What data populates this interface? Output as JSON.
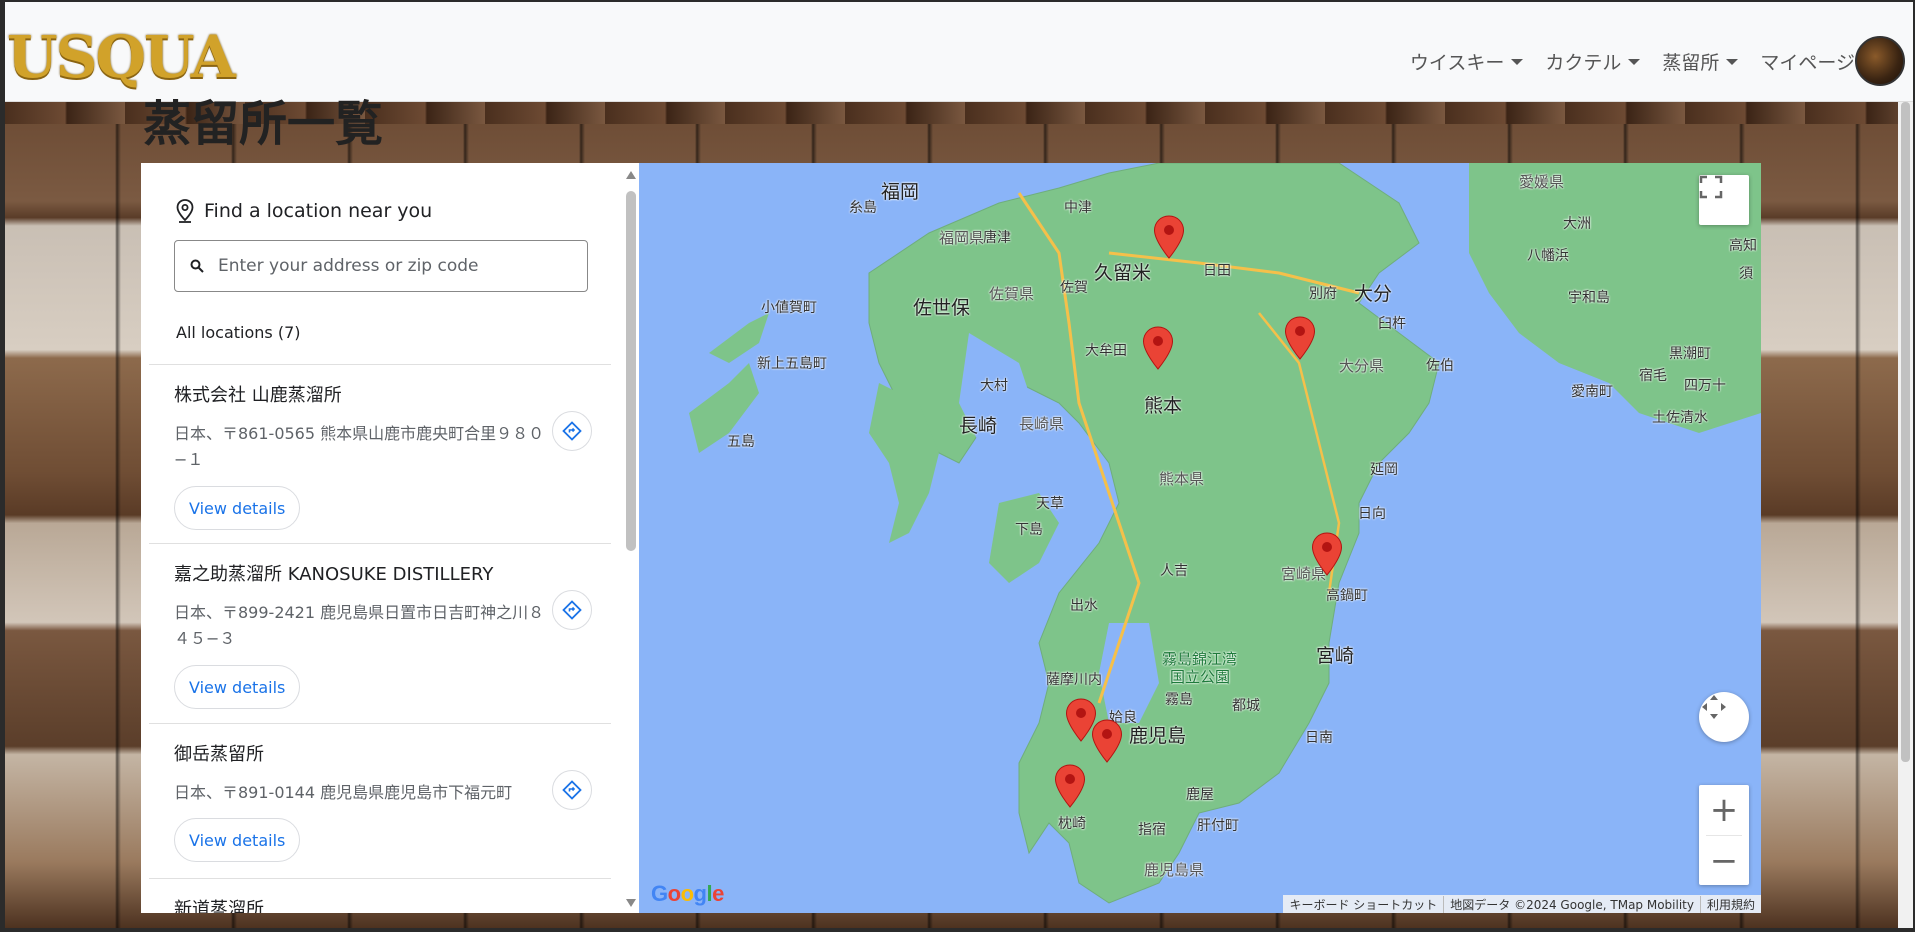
{
  "brand": "USQUA",
  "nav": {
    "items": [
      {
        "label": "ウイスキー",
        "dropdown": true
      },
      {
        "label": "カクテル",
        "dropdown": true
      },
      {
        "label": "蒸留所",
        "dropdown": true
      },
      {
        "label": "マイページ",
        "dropdown": false
      }
    ]
  },
  "page_title": "蒸留所一覧",
  "locator": {
    "heading": "Find a location near you",
    "search_placeholder": "Enter your address or zip code",
    "all_locations": "All locations (7)",
    "view_details_label": "View details",
    "locations": [
      {
        "name": "株式会社 山鹿蒸溜所",
        "address": "日本、〒861-0565 熊本県山鹿市鹿央町合里９８０−１"
      },
      {
        "name": "嘉之助蒸溜所 KANOSUKE DISTILLERY",
        "address": "日本、〒899-2421 鹿児島県日置市日吉町神之川８４５−３"
      },
      {
        "name": "御岳蒸留所",
        "address": "日本、〒891-0144 鹿児島県鹿児島市下福元町"
      },
      {
        "name": "新道蒸溜所",
        "address": ""
      }
    ]
  },
  "map": {
    "labels": [
      {
        "text": "福岡",
        "cls": "big"
      },
      {
        "text": "糸島",
        "cls": ""
      },
      {
        "text": "中津",
        "cls": ""
      },
      {
        "text": "愛媛県",
        "cls": "pref"
      },
      {
        "text": "唐津",
        "cls": ""
      },
      {
        "text": "福岡県",
        "cls": "pref"
      },
      {
        "text": "大洲",
        "cls": ""
      },
      {
        "text": "八幡浜",
        "cls": ""
      },
      {
        "text": "高知",
        "cls": ""
      },
      {
        "text": "須",
        "cls": ""
      },
      {
        "text": "久留米",
        "cls": "big"
      },
      {
        "text": "日田",
        "cls": ""
      },
      {
        "text": "佐賀県",
        "cls": "pref"
      },
      {
        "text": "佐賀",
        "cls": ""
      },
      {
        "text": "別府",
        "cls": ""
      },
      {
        "text": "大分",
        "cls": "big"
      },
      {
        "text": "宇和島",
        "cls": ""
      },
      {
        "text": "小値賀町",
        "cls": ""
      },
      {
        "text": "佐世保",
        "cls": "big"
      },
      {
        "text": "臼杵",
        "cls": ""
      },
      {
        "text": "大牟田",
        "cls": ""
      },
      {
        "text": "黒潮町",
        "cls": ""
      },
      {
        "text": "新上五島町",
        "cls": ""
      },
      {
        "text": "大分県",
        "cls": "pref"
      },
      {
        "text": "佐伯",
        "cls": ""
      },
      {
        "text": "宿毛",
        "cls": ""
      },
      {
        "text": "大村",
        "cls": ""
      },
      {
        "text": "愛南町",
        "cls": ""
      },
      {
        "text": "四万十",
        "cls": ""
      },
      {
        "text": "熊本",
        "cls": "big"
      },
      {
        "text": "長崎",
        "cls": "big"
      },
      {
        "text": "長崎県",
        "cls": "pref"
      },
      {
        "text": "土佐清水",
        "cls": ""
      },
      {
        "text": "五島",
        "cls": ""
      },
      {
        "text": "延岡",
        "cls": ""
      },
      {
        "text": "熊本県",
        "cls": "pref"
      },
      {
        "text": "天草",
        "cls": ""
      },
      {
        "text": "日向",
        "cls": ""
      },
      {
        "text": "下島",
        "cls": ""
      },
      {
        "text": "人吉",
        "cls": ""
      },
      {
        "text": "宮崎県",
        "cls": "pref"
      },
      {
        "text": "高鍋町",
        "cls": ""
      },
      {
        "text": "出水",
        "cls": ""
      },
      {
        "text": "霧島錦江湾",
        "cls": "park"
      },
      {
        "text": "国立公園",
        "cls": "park"
      },
      {
        "text": "宮崎",
        "cls": "big"
      },
      {
        "text": "薩摩川内",
        "cls": ""
      },
      {
        "text": "霧島",
        "cls": ""
      },
      {
        "text": "都城",
        "cls": ""
      },
      {
        "text": "姶良",
        "cls": ""
      },
      {
        "text": "鹿児島",
        "cls": "big"
      },
      {
        "text": "日南",
        "cls": ""
      },
      {
        "text": "鹿屋",
        "cls": ""
      },
      {
        "text": "肝付町",
        "cls": ""
      },
      {
        "text": "枕崎",
        "cls": ""
      },
      {
        "text": "指宿",
        "cls": ""
      },
      {
        "text": "鹿児島県",
        "cls": "pref"
      }
    ],
    "attribution": [
      "キーボード ショートカット",
      "地図データ ©2024 Google, TMap Mobility",
      "利用規約"
    ],
    "google_logo": "Google",
    "zoom_in": "+",
    "zoom_out": "−"
  },
  "colors": {
    "accent": "#1a73e8",
    "marker": "#ea4335",
    "brand": "#d1a22a"
  }
}
